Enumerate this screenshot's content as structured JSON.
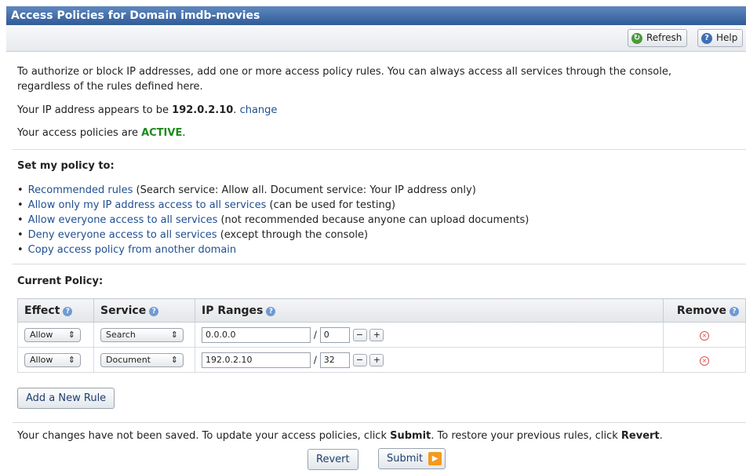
{
  "window": {
    "title": "Access Policies for Domain imdb-movies"
  },
  "toolbar": {
    "refresh_label": "Refresh",
    "help_label": "Help"
  },
  "intro": {
    "text": "To authorize or block IP addresses, add one or more access policy rules. You can always access all services through the console, regardless of the rules defined here.",
    "ip_prefix": "Your IP address appears to be ",
    "ip_address": "192.0.2.10",
    "ip_suffix": ".",
    "change_link": "change",
    "status_prefix": "Your access policies are ",
    "status_value": "ACTIVE",
    "status_suffix": "."
  },
  "policy_options": {
    "heading": "Set my policy to:",
    "items": [
      {
        "link": "Recommended rules",
        "note": " (Search service: Allow all. Document service: Your IP address only)"
      },
      {
        "link": "Allow only my IP address access to all services",
        "note": " (can be used for testing)"
      },
      {
        "link": "Allow everyone access to all services",
        "note": " (not recommended because anyone can upload documents)"
      },
      {
        "link": "Deny everyone access to all services",
        "note": " (except through the console)"
      },
      {
        "link": "Copy access policy from another domain",
        "note": ""
      }
    ]
  },
  "current_policy": {
    "heading": "Current Policy:",
    "columns": [
      "Effect",
      "Service",
      "IP Ranges",
      "Remove"
    ],
    "rows": [
      {
        "effect": "Allow",
        "service": "Search",
        "ip": "0.0.0.0",
        "prefix": "0"
      },
      {
        "effect": "Allow",
        "service": "Document",
        "ip": "192.0.2.10",
        "prefix": "32"
      }
    ],
    "add_rule_label": "Add a New Rule"
  },
  "footer": {
    "note_part1": "Your changes have not been saved. To update your access policies, click ",
    "submit_word": "Submit",
    "note_part2": ". To restore your previous rules, click ",
    "revert_word": "Revert",
    "note_part3": ".",
    "revert_label": "Revert",
    "submit_label": "Submit"
  },
  "colors": {
    "title_bar": "#3f6aa5",
    "link": "#1f4f91",
    "active": "#1c8a1c",
    "submit_accent": "#f39a1e"
  }
}
